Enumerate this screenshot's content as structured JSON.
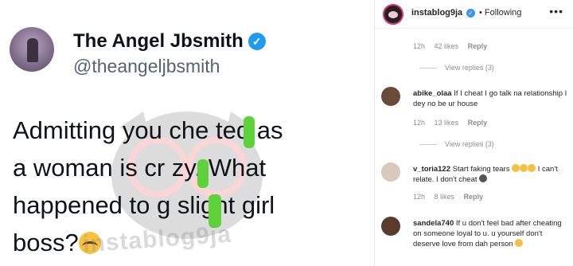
{
  "tweet": {
    "display_name": "The Angel Jbsmith",
    "handle": "@theangeljbsmith",
    "verified_icon": "verified-badge-icon",
    "body_lines": [
      "Admitting you che ted as",
      "a woman is cr zy. What",
      "happened to g slight girl",
      "boss?"
    ],
    "emoji": "crying-face-emoji",
    "watermark": "instablog9ja"
  },
  "instagram": {
    "account": "instablog9ja",
    "follow_status": "• Following",
    "more_icon": "•••",
    "top_meta": {
      "time": "12h",
      "likes": "42 likes",
      "reply": "Reply"
    },
    "view_replies_1": "View replies (3)",
    "comments": [
      {
        "username": "abike_olaa",
        "text": "If I cheat I go talk na relationship I dey no be ur house",
        "time": "12h",
        "likes": "13 likes",
        "reply": "Reply",
        "view_replies": "View replies (3)"
      },
      {
        "username": "v_toria122",
        "text": "Start faking tears",
        "text_after": "I can't relate. I don't cheat",
        "time": "12h",
        "likes": "8 likes",
        "reply": "Reply"
      },
      {
        "username": "sandela740",
        "text": "If u don't feel bad after cheating on someone loyal to u. u yourself don't deserve love from dah person"
      }
    ],
    "heart_icon": "♡",
    "colors": {
      "verified": "#3897f0",
      "meta": "#8e8e8e",
      "story_ring": "#e1306c"
    }
  }
}
